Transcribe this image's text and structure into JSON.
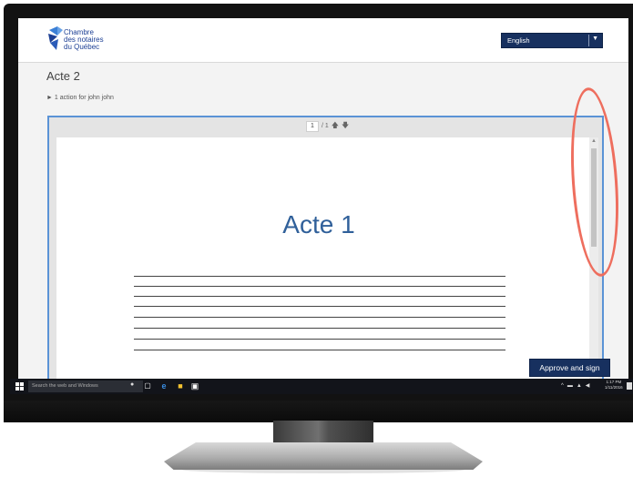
{
  "header": {
    "logo_lines": [
      "Chambre",
      "des notaires",
      "du Québec"
    ],
    "language": "English"
  },
  "page": {
    "title": "Acte 2",
    "actions_text": "1 action for john john"
  },
  "viewer": {
    "current_page": "1",
    "total_pages": "/ 1",
    "document_title": "Acte 1",
    "line_count": 8
  },
  "footer": {
    "approve_label": "Approve and sign"
  },
  "taskbar": {
    "search_placeholder": "Search the web and Windows",
    "clock_time": "1:17 PM",
    "clock_date": "1/11/2016"
  },
  "colors": {
    "brand_navy": "#17305f",
    "frame_blue": "#5a93d6",
    "doc_title": "#30609a",
    "annotation": "#ee6e5e"
  },
  "icons": [
    "windows-start-icon",
    "microphone-icon",
    "task-view-icon",
    "edge-icon",
    "file-explorer-icon",
    "store-icon",
    "arrow-up-icon",
    "arrow-down-icon",
    "chevron-down-icon"
  ]
}
